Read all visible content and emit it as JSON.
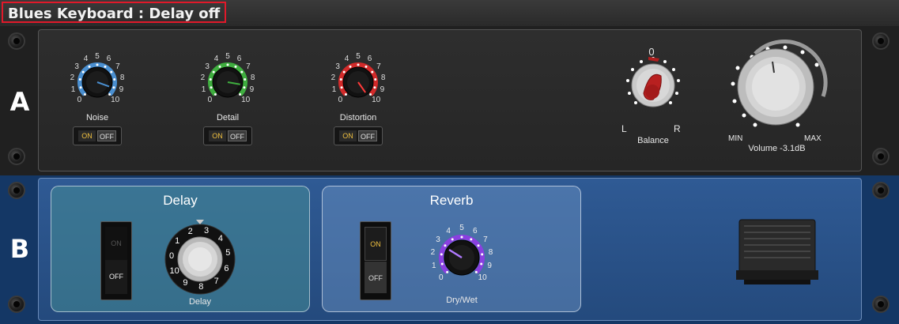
{
  "title": "Blues Keyboard : Delay off",
  "rows": {
    "a": "A",
    "b": "B"
  },
  "rackA": {
    "knobs": [
      {
        "name": "noise",
        "label": "Noise",
        "color": "#4a8fd0",
        "ticks": [
          "0",
          "1",
          "2",
          "3",
          "4",
          "5",
          "6",
          "7",
          "8",
          "9",
          "10"
        ],
        "toggle_on": "ON",
        "toggle_off": "OFF"
      },
      {
        "name": "detail",
        "label": "Detail",
        "color": "#3fae3f",
        "ticks": [
          "0",
          "1",
          "2",
          "3",
          "4",
          "5",
          "6",
          "7",
          "8",
          "9",
          "10"
        ],
        "toggle_on": "ON",
        "toggle_off": "OFF"
      },
      {
        "name": "distortion",
        "label": "Distortion",
        "color": "#d22a2a",
        "ticks": [
          "0",
          "1",
          "2",
          "3",
          "4",
          "5",
          "6",
          "7",
          "8",
          "9",
          "10"
        ],
        "toggle_on": "ON",
        "toggle_off": "OFF"
      }
    ],
    "balance": {
      "label": "Balance",
      "zero": "0",
      "left": "L",
      "right": "R"
    },
    "volume": {
      "label": "Volume -3.1dB",
      "min": "MIN",
      "max": "MAX"
    }
  },
  "rackB": {
    "delay": {
      "title": "Delay",
      "switch_on": "ON",
      "switch_off": "OFF",
      "knob_label": "Delay",
      "ticks": [
        "0",
        "1",
        "2",
        "3",
        "4",
        "5",
        "6",
        "7",
        "8",
        "9",
        "10"
      ]
    },
    "reverb": {
      "title": "Reverb",
      "switch_on": "ON",
      "switch_off": "OFF",
      "knob_label": "Dry/Wet",
      "ticks": [
        "0",
        "1",
        "2",
        "3",
        "4",
        "5",
        "6",
        "7",
        "8",
        "9",
        "10"
      ],
      "color": "#8a3fe0"
    }
  },
  "colors": {
    "title_border": "#e0192a",
    "rackB_panel": "#2f5a94"
  }
}
